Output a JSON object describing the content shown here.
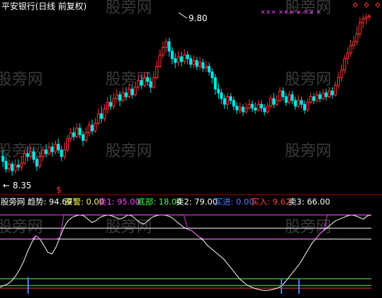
{
  "watermark": "股旁网",
  "upper": {
    "title": "平安银行(日线 前复权)",
    "high_label": "9.80",
    "low_label": "8.35",
    "low_arrow": "←",
    "price_range": [
      8.2,
      10.05
    ],
    "marker_symbol": "$",
    "top_markers": "××× ××× × ×× ×",
    "bar_count": 120,
    "bars": [
      [
        8.55,
        8.5,
        8.62,
        8.44
      ],
      [
        8.5,
        8.42,
        8.55,
        8.38
      ],
      [
        8.42,
        8.47,
        8.52,
        8.38
      ],
      [
        8.47,
        8.4,
        8.5,
        8.35
      ],
      [
        8.4,
        8.46,
        8.52,
        8.37
      ],
      [
        8.46,
        8.44,
        8.52,
        8.4
      ],
      [
        8.44,
        8.48,
        8.55,
        8.4
      ],
      [
        8.48,
        8.58,
        8.62,
        8.46
      ],
      [
        8.58,
        8.55,
        8.66,
        8.5
      ],
      [
        8.55,
        8.6,
        8.66,
        8.52
      ],
      [
        8.6,
        8.52,
        8.65,
        8.48
      ],
      [
        8.52,
        8.45,
        8.56,
        8.4
      ],
      [
        8.45,
        8.55,
        8.6,
        8.42
      ],
      [
        8.55,
        8.62,
        8.66,
        8.5
      ],
      [
        8.62,
        8.58,
        8.68,
        8.54
      ],
      [
        8.58,
        8.65,
        8.7,
        8.56
      ],
      [
        8.65,
        8.6,
        8.7,
        8.55
      ],
      [
        8.6,
        8.68,
        8.72,
        8.57
      ],
      [
        8.68,
        8.62,
        8.74,
        8.58
      ],
      [
        8.62,
        8.55,
        8.66,
        8.5
      ],
      [
        8.55,
        8.62,
        8.7,
        8.52
      ],
      [
        8.62,
        8.74,
        8.78,
        8.6
      ],
      [
        8.74,
        8.8,
        8.85,
        8.7
      ],
      [
        8.8,
        8.76,
        8.86,
        8.72
      ],
      [
        8.76,
        8.85,
        8.9,
        8.74
      ],
      [
        8.85,
        8.78,
        8.9,
        8.74
      ],
      [
        8.78,
        8.72,
        8.82,
        8.66
      ],
      [
        8.72,
        8.8,
        8.86,
        8.7
      ],
      [
        8.8,
        8.88,
        8.92,
        8.76
      ],
      [
        8.88,
        8.82,
        8.94,
        8.78
      ],
      [
        8.82,
        8.9,
        8.96,
        8.8
      ],
      [
        8.9,
        9.0,
        9.06,
        8.88
      ],
      [
        9.0,
        8.95,
        9.08,
        8.9
      ],
      [
        8.95,
        9.05,
        9.1,
        8.92
      ],
      [
        9.05,
        9.12,
        9.18,
        9.0
      ],
      [
        9.12,
        9.08,
        9.2,
        9.04
      ],
      [
        9.08,
        9.16,
        9.22,
        9.05
      ],
      [
        9.16,
        9.2,
        9.26,
        9.12
      ],
      [
        9.2,
        9.14,
        9.24,
        9.08
      ],
      [
        9.14,
        9.22,
        9.28,
        9.12
      ],
      [
        9.22,
        9.18,
        9.28,
        9.14
      ],
      [
        9.18,
        9.26,
        9.32,
        9.16
      ],
      [
        9.26,
        9.2,
        9.3,
        9.16
      ],
      [
        9.2,
        9.28,
        9.34,
        9.18
      ],
      [
        9.28,
        9.35,
        9.4,
        9.25
      ],
      [
        9.35,
        9.3,
        9.42,
        9.26
      ],
      [
        9.3,
        9.38,
        9.44,
        9.28
      ],
      [
        9.38,
        9.34,
        9.44,
        9.3
      ],
      [
        9.34,
        9.28,
        9.38,
        9.22
      ],
      [
        9.28,
        9.38,
        9.45,
        9.26
      ],
      [
        9.38,
        9.5,
        9.56,
        9.36
      ],
      [
        9.5,
        9.62,
        9.68,
        9.48
      ],
      [
        9.62,
        9.7,
        9.76,
        9.58
      ],
      [
        9.7,
        9.76,
        9.8,
        9.64
      ],
      [
        9.76,
        9.66,
        9.8,
        9.6
      ],
      [
        9.66,
        9.58,
        9.7,
        9.52
      ],
      [
        9.58,
        9.54,
        9.64,
        9.48
      ],
      [
        9.54,
        9.6,
        9.66,
        9.5
      ],
      [
        9.6,
        9.55,
        9.65,
        9.5
      ],
      [
        9.55,
        9.62,
        9.68,
        9.52
      ],
      [
        9.62,
        9.58,
        9.66,
        9.52
      ],
      [
        9.58,
        9.52,
        9.62,
        9.48
      ],
      [
        9.52,
        9.56,
        9.62,
        9.48
      ],
      [
        9.56,
        9.5,
        9.6,
        9.46
      ],
      [
        9.5,
        9.54,
        9.6,
        9.46
      ],
      [
        9.54,
        9.48,
        9.58,
        9.44
      ],
      [
        9.48,
        9.5,
        9.56,
        9.44
      ],
      [
        9.5,
        9.44,
        9.54,
        9.4
      ],
      [
        9.44,
        9.38,
        9.48,
        9.32
      ],
      [
        9.38,
        9.26,
        9.42,
        9.2
      ],
      [
        9.26,
        9.22,
        9.32,
        9.16
      ],
      [
        9.22,
        9.16,
        9.26,
        9.1
      ],
      [
        9.16,
        9.1,
        9.2,
        9.05
      ],
      [
        9.1,
        9.18,
        9.22,
        9.04
      ],
      [
        9.18,
        9.14,
        9.22,
        9.1
      ],
      [
        9.14,
        9.08,
        9.18,
        9.04
      ],
      [
        9.08,
        9.04,
        9.12,
        9.0
      ],
      [
        9.04,
        9.07,
        9.12,
        9.0
      ],
      [
        9.07,
        9.02,
        9.1,
        8.98
      ],
      [
        9.02,
        9.06,
        9.12,
        9.0
      ],
      [
        9.06,
        9.1,
        9.15,
        9.04
      ],
      [
        9.1,
        9.06,
        9.14,
        9.02
      ],
      [
        9.06,
        9.04,
        9.12,
        9.0
      ],
      [
        9.04,
        9.1,
        9.14,
        9.02
      ],
      [
        9.1,
        9.06,
        9.14,
        9.02
      ],
      [
        9.06,
        9.02,
        9.1,
        8.98
      ],
      [
        9.02,
        9.08,
        9.12,
        9.0
      ],
      [
        9.08,
        9.16,
        9.2,
        9.06
      ],
      [
        9.16,
        9.1,
        9.22,
        9.06
      ],
      [
        9.1,
        9.14,
        9.2,
        9.08
      ],
      [
        9.14,
        9.24,
        9.28,
        9.12
      ],
      [
        9.24,
        9.18,
        9.28,
        9.14
      ],
      [
        9.18,
        9.12,
        9.22,
        9.08
      ],
      [
        9.12,
        9.2,
        9.24,
        9.1
      ],
      [
        9.2,
        9.14,
        9.24,
        9.1
      ],
      [
        9.14,
        9.08,
        9.18,
        9.04
      ],
      [
        9.08,
        9.14,
        9.2,
        9.06
      ],
      [
        9.14,
        9.1,
        9.18,
        9.06
      ],
      [
        9.1,
        9.04,
        9.14,
        9.0
      ],
      [
        9.04,
        9.12,
        9.16,
        9.02
      ],
      [
        9.12,
        9.18,
        9.22,
        9.1
      ],
      [
        9.18,
        9.14,
        9.22,
        9.1
      ],
      [
        9.14,
        9.2,
        9.24,
        9.12
      ],
      [
        9.2,
        9.16,
        9.24,
        9.12
      ],
      [
        9.16,
        9.22,
        9.26,
        9.14
      ],
      [
        9.22,
        9.18,
        9.26,
        9.14
      ],
      [
        9.18,
        9.24,
        9.28,
        9.16
      ],
      [
        9.24,
        9.2,
        9.28,
        9.16
      ],
      [
        9.2,
        9.3,
        9.34,
        9.18
      ],
      [
        9.3,
        9.38,
        9.44,
        9.26
      ],
      [
        9.38,
        9.46,
        9.52,
        9.34
      ],
      [
        9.46,
        9.58,
        9.62,
        9.42
      ],
      [
        9.58,
        9.64,
        9.7,
        9.52
      ],
      [
        9.64,
        9.72,
        9.78,
        9.6
      ],
      [
        9.72,
        9.76,
        9.82,
        9.68
      ],
      [
        9.76,
        9.84,
        9.92,
        9.72
      ],
      [
        9.84,
        9.96,
        10.02,
        9.8
      ],
      [
        9.96,
        10.0,
        10.04,
        9.9
      ],
      [
        10.0,
        10.02,
        10.05,
        9.94
      ],
      [
        10.02,
        10.03,
        10.05,
        9.98
      ]
    ]
  },
  "lower": {
    "legend": [
      {
        "text": "股旁网",
        "color": "#ffffff"
      },
      {
        "text": "趋势: 94.69",
        "color": "#ffffff"
      },
      {
        "text": "买警: 0.00",
        "color": "#ffff55"
      },
      {
        "text": "卖1: 95.00",
        "color": "#ff44ff"
      },
      {
        "text": "底部: 18.00",
        "color": "#44ff44"
      },
      {
        "text": "卖2: 79.00",
        "color": "#ffffff"
      },
      {
        "text": "买进: 0.00",
        "color": "#5577ff"
      },
      {
        "text": "买入: 9.62",
        "color": "#ff4444"
      },
      {
        "text": "卖3: 66.00",
        "color": "#ffffff"
      }
    ],
    "value_range": [
      0,
      100
    ],
    "reference_lines": [
      {
        "name": "卖1",
        "value": 95,
        "color": "#ff44ff"
      },
      {
        "name": "卖2",
        "value": 79,
        "color": "#ffffff"
      },
      {
        "name": "卖3",
        "value": 66,
        "color": "#ffffff"
      },
      {
        "name": "底部",
        "value": 18,
        "color": "#44ff44"
      },
      {
        "name": "底部2",
        "value": 10,
        "color": "#44ff44"
      }
    ],
    "trend": [
      8,
      10,
      12,
      16,
      22,
      30,
      40,
      52,
      62,
      70,
      66,
      58,
      50,
      48,
      56,
      68,
      80,
      88,
      92,
      94,
      95,
      94,
      90,
      86,
      88,
      92,
      94,
      95,
      94,
      92,
      90,
      92,
      95,
      94,
      90,
      86,
      84,
      88,
      92,
      94,
      95,
      95,
      94,
      92,
      88,
      84,
      80,
      78,
      76,
      72,
      68,
      64,
      58,
      54,
      50,
      46,
      42,
      36,
      30,
      24,
      18,
      14,
      10,
      8,
      6,
      5,
      4,
      4,
      5,
      6,
      8,
      12,
      18,
      24,
      30,
      36,
      44,
      52,
      60,
      66,
      72,
      76,
      80,
      84,
      88,
      90,
      92,
      94,
      95,
      94,
      92,
      90,
      94,
      95
    ],
    "buy_signal": [
      20,
      0,
      0,
      0,
      0,
      0,
      0,
      0,
      0,
      0,
      0,
      0,
      0,
      0,
      0,
      0,
      0,
      0,
      0,
      0,
      0,
      0,
      0,
      0,
      0,
      0,
      0,
      0,
      0,
      0,
      0,
      0,
      0,
      0,
      0,
      0,
      0,
      0,
      0,
      0,
      0,
      0,
      0,
      0,
      0,
      0,
      0,
      0,
      0,
      0,
      0,
      0,
      0,
      0,
      0,
      0,
      0,
      0,
      0,
      0,
      0,
      0,
      0,
      0,
      0,
      0,
      0,
      0,
      0,
      0,
      0,
      0,
      0,
      0,
      0,
      0,
      0,
      0,
      0,
      0,
      0,
      0,
      0,
      0,
      0,
      0,
      0,
      0,
      0,
      0,
      0,
      0,
      0,
      0
    ],
    "buy_in": [
      9.62
    ]
  }
}
